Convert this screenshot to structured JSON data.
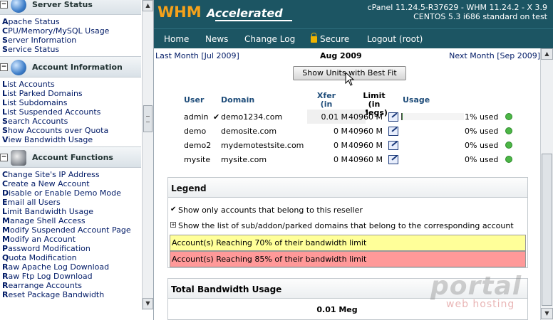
{
  "sidebar": {
    "sections": [
      {
        "title": "Server Status",
        "toggle": "−",
        "links": [
          "Apache Status",
          "CPU/Memory/MySQL Usage",
          "Server Information",
          "Service Status"
        ]
      },
      {
        "title": "Account Information",
        "toggle": "−",
        "links": [
          "List Accounts",
          "List Parked Domains",
          "List Subdomains",
          "List Suspended Accounts",
          "Search Accounts",
          "Show Accounts over Quota",
          "View Bandwidth Usage"
        ]
      },
      {
        "title": "Account Functions",
        "toggle": "−",
        "links": [
          "Change Site's IP Address",
          "Create a New Account",
          "Disable or Enable Demo Mode",
          "Email all Users",
          "Limit Bandwidth Usage",
          "Manage Shell Access",
          "Modify Suspended Account Page",
          "Modify an Account",
          "Password Modification",
          "Quota Modification",
          "Raw Apache Log Download",
          "Raw Ftp Log Download",
          "Rearrange Accounts",
          "Reset Package Bandwidth"
        ]
      }
    ]
  },
  "header": {
    "logo_main": "WHM",
    "logo_sub": "Accelerated",
    "version_line1": "cPanel 11.24.5-R37629 - WHM 11.24.2 - X 3.9",
    "version_line2": "CENTOS 5.3 i686 standard on test"
  },
  "nav": {
    "home": "Home",
    "news": "News",
    "changelog": "Change Log",
    "secure": "Secure",
    "logout": "Logout (root)"
  },
  "bandwidth": {
    "prev_month": "Last Month [Jul 2009]",
    "current_month": "Aug 2009",
    "next_month": "Next Month [Sep 2009]",
    "best_fit_button": "Show Units with Best Fit",
    "columns": {
      "user": "User",
      "domain": "Domain",
      "xfer_1": "Xfer",
      "xfer_2": "(in Megs)",
      "limit_1": "Limit",
      "limit_2": "(in Megs)",
      "usage": "Usage"
    },
    "rows": [
      {
        "user": "admin",
        "owned": "✔",
        "domain": "demo1234.com",
        "xfer": "0.01 M",
        "limit": "40960 M",
        "used": "1% used",
        "used_fraction": 0.01
      },
      {
        "user": "demo",
        "owned": "",
        "domain": "demosite.com",
        "xfer": "0 M",
        "limit": "40960 M",
        "used": "0% used",
        "used_fraction": 0
      },
      {
        "user": "demo2",
        "owned": "",
        "domain": "mydemotestsite.com",
        "xfer": "0 M",
        "limit": "40960 M",
        "used": "0% used",
        "used_fraction": 0
      },
      {
        "user": "mysite",
        "owned": "",
        "domain": "mysite.com",
        "xfer": "0 M",
        "limit": "40960 M",
        "used": "0% used",
        "used_fraction": 0
      }
    ]
  },
  "legend": {
    "title": "Legend",
    "item1_mark": "✔",
    "item1": "Show only accounts that belong to this reseller",
    "item2_mark": "+",
    "item2": "Show the list of sub/addon/parked domains that belong to the corresponding account",
    "warn70": "Account(s) Reaching 70% of their bandwidth limit",
    "warn85": "Account(s) Reaching 85% of their bandwidth limit",
    "warn70_color": "#ffff99",
    "warn85_color": "#ff9999"
  },
  "total": {
    "title": "Total Bandwidth Usage",
    "value": "0.01 Meg"
  },
  "watermark": {
    "brand": "portal",
    "tagline": "web hosting"
  },
  "colors": {
    "banner": "#1c5563",
    "logo_orange": "#f5a21b",
    "link": "#001a66",
    "header_blue": "#1f4d7a",
    "ok_green": "#4cb646"
  }
}
